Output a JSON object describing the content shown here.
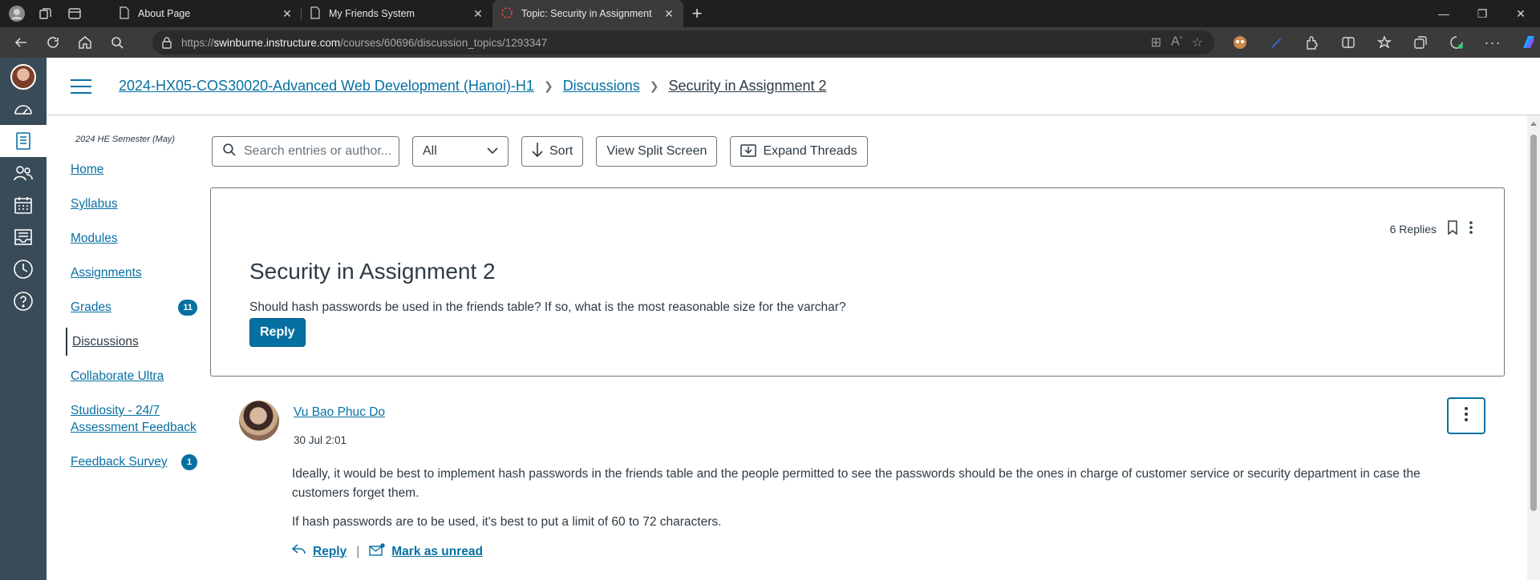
{
  "browser": {
    "tabs": [
      {
        "title": "About Page",
        "icon": "page-icon",
        "active": false
      },
      {
        "title": "My Friends System",
        "icon": "page-icon",
        "active": false
      },
      {
        "title": "Topic: Security in Assignment 2",
        "icon": "loading-icon",
        "active": true
      }
    ],
    "url_prefix": "https://",
    "url_host": "swinburne.instructure.com",
    "url_path": "/courses/60696/discussion_topics/1293347"
  },
  "breadcrumb": {
    "course": "2024-HX05-COS30020-Advanced Web Development (Hanoi)-H1",
    "section": "Discussions",
    "current": "Security in Assignment 2"
  },
  "course_nav": {
    "term": "2024 HE Semester (May)",
    "items": [
      {
        "label": "Home",
        "badge": ""
      },
      {
        "label": "Syllabus",
        "badge": ""
      },
      {
        "label": "Modules",
        "badge": ""
      },
      {
        "label": "Assignments",
        "badge": ""
      },
      {
        "label": "Grades",
        "badge": "11"
      },
      {
        "label": "Discussions",
        "badge": ""
      },
      {
        "label": "Collaborate Ultra",
        "badge": ""
      },
      {
        "label": "Studiosity - 24/7 Assessment Feedback",
        "badge": ""
      },
      {
        "label": "Feedback Survey",
        "badge": "1"
      }
    ]
  },
  "toolbar": {
    "search_placeholder": "Search entries or author...",
    "filter_value": "All",
    "sort_label": "Sort",
    "split_label": "View Split Screen",
    "expand_label": "Expand Threads"
  },
  "topic": {
    "replies": "6 Replies",
    "title": "Security in Assignment 2",
    "body": "Should hash passwords be used in the friends table? If so, what is the most reasonable size for the varchar?",
    "reply_label": "Reply"
  },
  "entry": {
    "author": "Vu Bao Phuc Do",
    "date": "30 Jul 2:01",
    "paragraph1": "Ideally, it would be best to implement hash passwords in the friends table and the people permitted to see the passwords should be the ones in charge of customer service or security department in case the customers forget them.",
    "paragraph2": "If hash passwords are to be used, it's best to put a limit of 60 to 72 characters.",
    "reply_label": "Reply",
    "mark_unread_label": "Mark as unread"
  },
  "colors": {
    "link": "#0770a3",
    "nav_bg": "#394b58",
    "text": "#2d3b45"
  }
}
